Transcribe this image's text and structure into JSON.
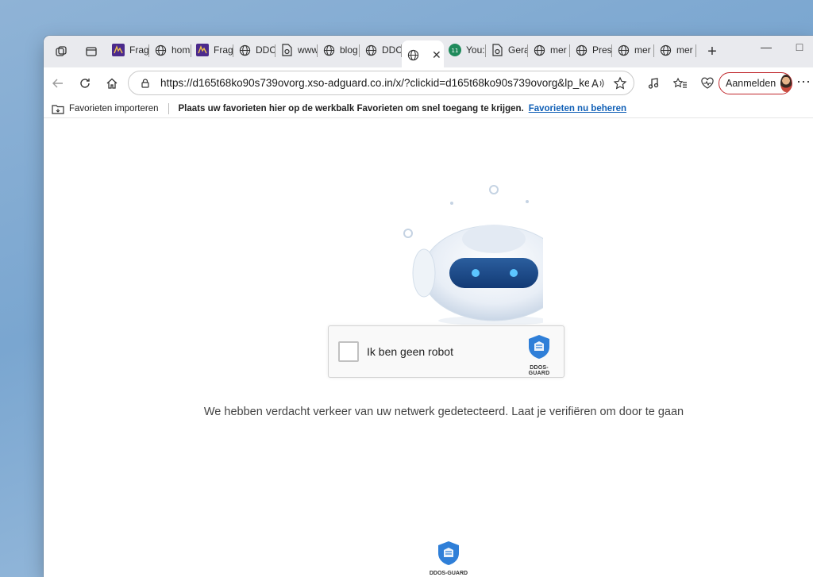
{
  "browser": {
    "tabs": [
      {
        "title": "Frag",
        "icon": "purple-app-icon"
      },
      {
        "title": "hom",
        "icon": "globe-icon"
      },
      {
        "title": "Frag",
        "icon": "purple-app-icon"
      },
      {
        "title": "DDC",
        "icon": "globe-icon"
      },
      {
        "title": "www",
        "icon": "page-gear-icon"
      },
      {
        "title": "blog",
        "icon": "globe-icon"
      },
      {
        "title": "DDC",
        "icon": "globe-icon"
      },
      {
        "title": "",
        "icon": "globe-icon",
        "active": true
      },
      {
        "title": "You:",
        "icon": "green-app-icon"
      },
      {
        "title": "Gera",
        "icon": "page-gear-icon"
      },
      {
        "title": "mer",
        "icon": "globe-icon"
      },
      {
        "title": "Pres",
        "icon": "globe-icon"
      },
      {
        "title": "mer",
        "icon": "globe-icon"
      },
      {
        "title": "mer",
        "icon": "globe-icon"
      }
    ],
    "address_bar": {
      "url": "https://d165t68ko90s739ovorg.xso-adguard.co.in/x/?clickid=d165t68ko90s739ovorg&lp_key=..."
    },
    "signin_label": "Aanmelden",
    "favorites_bar": {
      "import_label": "Favorieten importeren",
      "hint": "Plaats uw favorieten hier op de werkbalk Favorieten om snel toegang te krijgen.",
      "manage_link": "Favorieten nu beheren"
    },
    "accent_color": "#c0292e"
  },
  "page": {
    "captcha": {
      "label": "Ik ben geen robot",
      "brand": "DDOS-GUARD",
      "checked": false
    },
    "message": "We hebben verdacht verkeer van uw netwerk gedetecteerd. Laat je verifiëren om door te gaan",
    "footer_brand": "DDOS-GUARD",
    "brand_color": "#2f7fd8"
  }
}
